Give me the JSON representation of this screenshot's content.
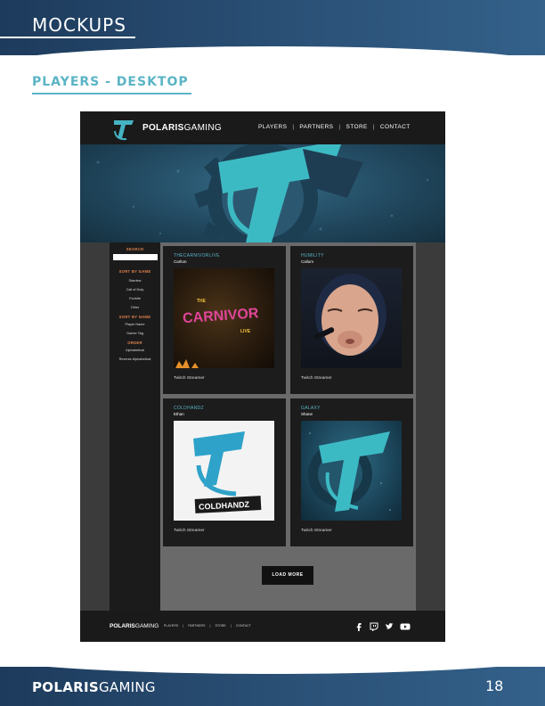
{
  "document": {
    "header_title": "MOCKUPS",
    "section_title": "PLAYERS - DESKTOP",
    "footer_brand_bold": "POLARIS",
    "footer_brand_light": "GAMING",
    "page_number": "18",
    "brand_color": "#2b5177",
    "accent_color": "#5ab4c5"
  },
  "site": {
    "logo_bold": "POLARIS",
    "logo_light": "GAMING",
    "nav": [
      "PLAYERS",
      "PARTNERS",
      "STORE",
      "CONTACT"
    ],
    "nav_separator": "|"
  },
  "sidebar": {
    "search_heading": "SEARCH",
    "sort_by_game_heading": "SORT BY GAME",
    "games": [
      "Stardew",
      "Call of Duty",
      "Fortnite",
      "Other"
    ],
    "sort_by_name_heading": "SORT BY NAME",
    "names": [
      "Player Name",
      "Gamer Tag"
    ],
    "order_heading": "ORDER",
    "orders": [
      "Alphabetical",
      "Reverse Alphabetical"
    ]
  },
  "players": [
    {
      "title": "THECARNIVORLIVE",
      "subtitle": "Carlton",
      "role": "Twitch Streamer",
      "image": "carnivor-live-logo",
      "image_text": [
        "THE",
        "CARNIVOR",
        "LIVE"
      ]
    },
    {
      "title": "HUMILITY",
      "subtitle": "Callum",
      "role": "Twitch Streamer",
      "image": "player-photo"
    },
    {
      "title": "COLDHANDZ",
      "subtitle": "Ethan",
      "role": "Twitch Streamer",
      "image": "coldhandz-logo",
      "image_text": [
        "COLDHANDZ"
      ]
    },
    {
      "title": "GALAXY",
      "subtitle": "Shane",
      "role": "Twitch Streamer",
      "image": "galaxy-logo"
    }
  ],
  "load_more": "LOAD MORE",
  "site_footer": {
    "logo_bold": "POLARIS",
    "logo_light": "GAMING",
    "links": [
      "PLAYERS",
      "|",
      "PARTNERS",
      "|",
      "STORE",
      "|",
      "CONTACT"
    ],
    "social": [
      "facebook-icon",
      "twitch-icon",
      "twitter-icon",
      "youtube-icon"
    ]
  }
}
